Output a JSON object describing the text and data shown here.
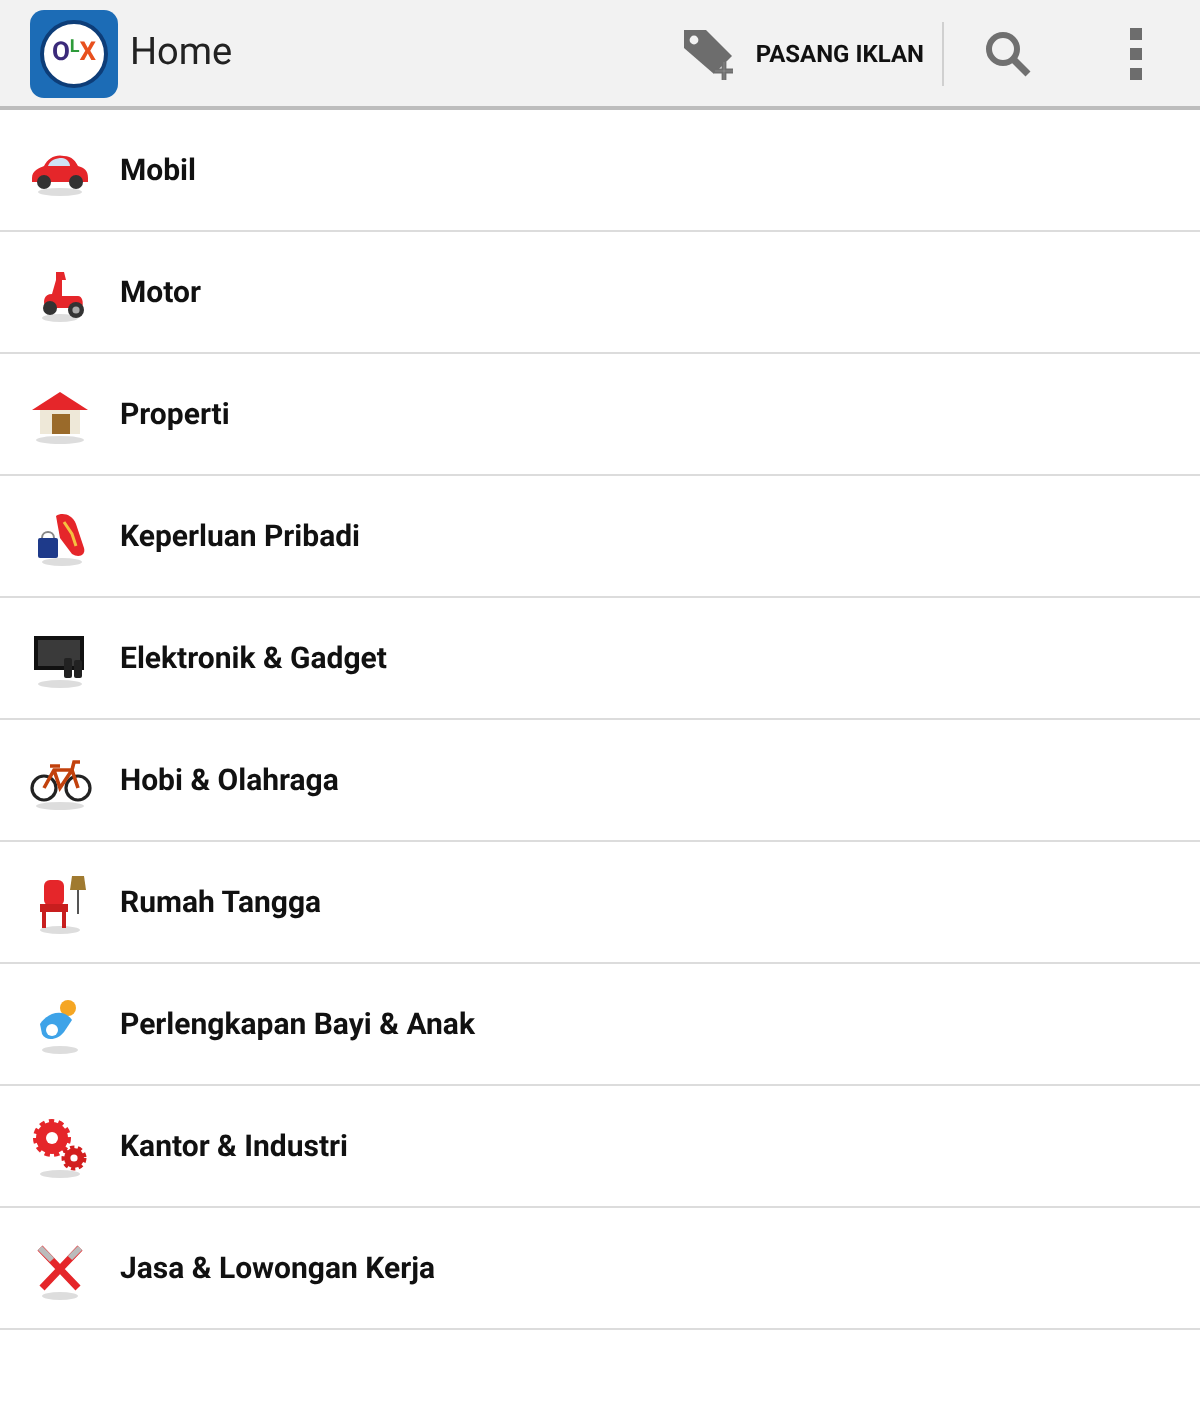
{
  "app_bar": {
    "logo_letters": [
      {
        "text": "O",
        "color": "#3b2a7a"
      },
      {
        "text": "L",
        "color": "#2e9b3a"
      },
      {
        "text": "X",
        "color": "#e8501e"
      }
    ],
    "title": "Home",
    "post_ad": "PASANG IKLAN"
  },
  "categories": [
    {
      "label": "Mobil",
      "kind": "car"
    },
    {
      "label": "Motor",
      "kind": "scooter"
    },
    {
      "label": "Properti",
      "kind": "house"
    },
    {
      "label": "Keperluan Pribadi",
      "kind": "shoes"
    },
    {
      "label": "Elektronik & Gadget",
      "kind": "tv"
    },
    {
      "label": "Hobi & Olahraga",
      "kind": "bicycle"
    },
    {
      "label": "Rumah Tangga",
      "kind": "chair"
    },
    {
      "label": "Perlengkapan Bayi & Anak",
      "kind": "pacifier"
    },
    {
      "label": "Kantor & Industri",
      "kind": "gears"
    },
    {
      "label": "Jasa & Lowongan Kerja",
      "kind": "tools"
    }
  ]
}
